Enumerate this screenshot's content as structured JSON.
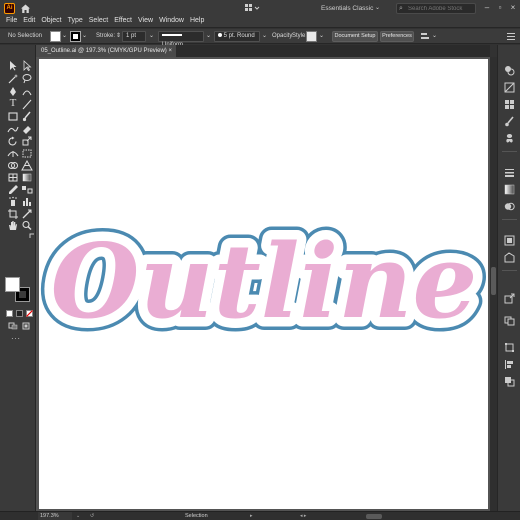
{
  "app": {
    "logo_text": "Ai"
  },
  "menu": [
    "File",
    "Edit",
    "Object",
    "Type",
    "Select",
    "Effect",
    "View",
    "Window",
    "Help"
  ],
  "workspace": {
    "label": "Essentials Classic"
  },
  "stock_search": {
    "placeholder": "Search Adobe Stock"
  },
  "controlbar": {
    "selection_label": "No Selection",
    "stroke_label": "Stroke:",
    "stroke_weight": "1 pt",
    "profile_label": "Uniform",
    "brush_label": "5 pt. Round",
    "opacity_label": "Opacity",
    "style_label": "Style:",
    "doc_setup_label": "Document Setup",
    "preferences_label": "Preferences"
  },
  "document_tab": {
    "title": "05_Outline.ai @ 197.3% (CMYK/GPU Preview)"
  },
  "artwork": {
    "word": "Outline",
    "fill_color": "#eaadd3",
    "outline_color": "#4b8ab1"
  },
  "statusbar": {
    "zoom": "197.3%",
    "tool": "Selection"
  }
}
